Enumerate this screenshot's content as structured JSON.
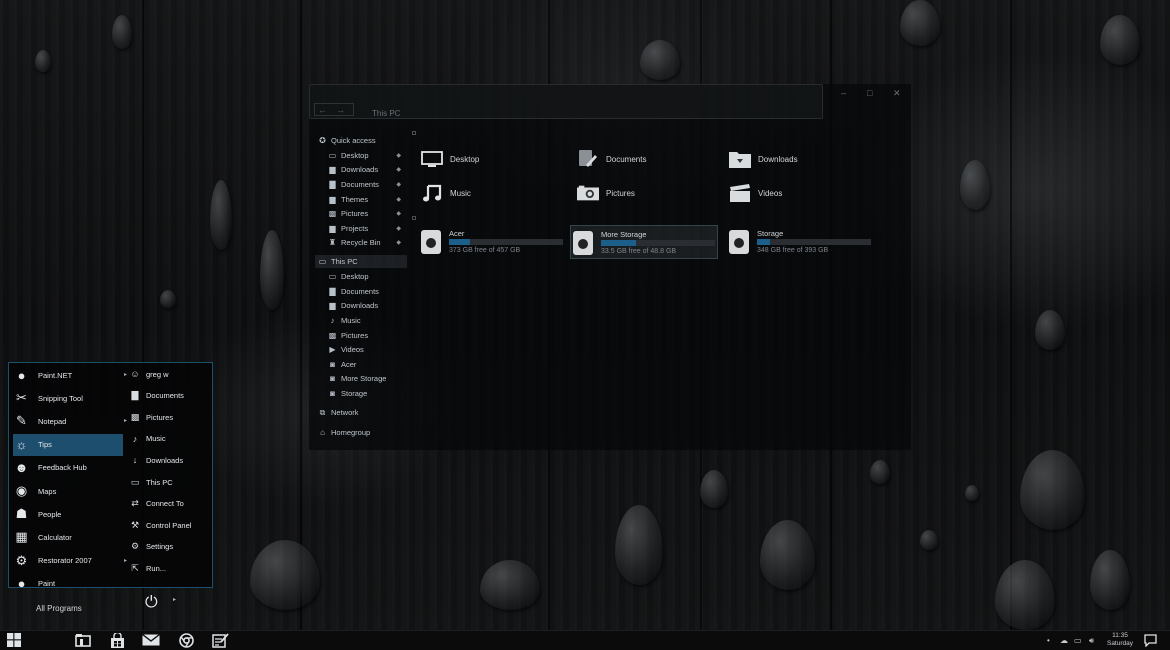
{
  "explorer": {
    "title": "This PC",
    "nav": {
      "back": "←",
      "forward": "→"
    },
    "window_controls": {
      "minimize": "–",
      "maximize": "□",
      "close": "✕"
    },
    "sidebar": [
      {
        "label": "Quick access",
        "icon": "quick-access-icon",
        "level": 0,
        "pinned": false
      },
      {
        "label": "Desktop",
        "icon": "desktop-icon",
        "level": 1,
        "pinned": true
      },
      {
        "label": "Downloads",
        "icon": "downloads-folder-icon",
        "level": 1,
        "pinned": true
      },
      {
        "label": "Documents",
        "icon": "documents-icon",
        "level": 1,
        "pinned": true
      },
      {
        "label": "Themes",
        "icon": "folder-icon",
        "level": 1,
        "pinned": true
      },
      {
        "label": "Pictures",
        "icon": "pictures-icon",
        "level": 1,
        "pinned": true
      },
      {
        "label": "Projects",
        "icon": "folder-icon",
        "level": 1,
        "pinned": true
      },
      {
        "label": "Recycle Bin",
        "icon": "recycle-bin-icon",
        "level": 1,
        "pinned": true
      },
      {
        "label": "This PC",
        "icon": "computer-icon",
        "level": 0,
        "pinned": false,
        "selected": true
      },
      {
        "label": "Desktop",
        "icon": "desktop-icon",
        "level": 1,
        "pinned": false
      },
      {
        "label": "Documents",
        "icon": "documents-icon",
        "level": 1,
        "pinned": false
      },
      {
        "label": "Downloads",
        "icon": "downloads-folder-icon",
        "level": 1,
        "pinned": false
      },
      {
        "label": "Music",
        "icon": "music-icon",
        "level": 1,
        "pinned": false
      },
      {
        "label": "Pictures",
        "icon": "pictures-icon",
        "level": 1,
        "pinned": false
      },
      {
        "label": "Videos",
        "icon": "videos-icon",
        "level": 1,
        "pinned": false
      },
      {
        "label": "Acer",
        "icon": "drive-icon",
        "level": 1,
        "pinned": false
      },
      {
        "label": "More Storage",
        "icon": "drive-icon",
        "level": 1,
        "pinned": false
      },
      {
        "label": "Storage",
        "icon": "drive-icon",
        "level": 1,
        "pinned": false
      },
      {
        "label": "Network",
        "icon": "network-icon",
        "level": 0,
        "pinned": false
      },
      {
        "label": "Homegroup",
        "icon": "homegroup-icon",
        "level": 0,
        "pinned": false
      }
    ],
    "folders": [
      {
        "label": "Desktop",
        "icon": "desktop-icon"
      },
      {
        "label": "Documents",
        "icon": "documents-icon"
      },
      {
        "label": "Downloads",
        "icon": "downloads-folder-icon"
      },
      {
        "label": "Music",
        "icon": "music-icon"
      },
      {
        "label": "Pictures",
        "icon": "camera-icon"
      },
      {
        "label": "Videos",
        "icon": "clapperboard-icon"
      }
    ],
    "drives": [
      {
        "name": "Acer",
        "free_text": "373 GB free of 457 GB",
        "used_fraction": 0.18,
        "selected": false
      },
      {
        "name": "More Storage",
        "free_text": "33.5 GB free of 48.8 GB",
        "used_fraction": 0.31,
        "selected": true
      },
      {
        "name": "Storage",
        "free_text": "348 GB free of 393 GB",
        "used_fraction": 0.11,
        "selected": false
      }
    ]
  },
  "start_menu": {
    "apps": [
      {
        "label": "Paint.NET",
        "icon": "paint-net-icon",
        "has_submenu": true
      },
      {
        "label": "Snipping Tool",
        "icon": "snipping-tool-icon",
        "has_submenu": false
      },
      {
        "label": "Notepad",
        "icon": "notepad-icon",
        "has_submenu": true
      },
      {
        "label": "Tips",
        "icon": "lightbulb-icon",
        "has_submenu": false,
        "selected": true
      },
      {
        "label": "Feedback Hub",
        "icon": "feedback-icon",
        "has_submenu": false
      },
      {
        "label": "Maps",
        "icon": "maps-icon",
        "has_submenu": false
      },
      {
        "label": "People",
        "icon": "people-icon",
        "has_submenu": false
      },
      {
        "label": "Calculator",
        "icon": "calculator-icon",
        "has_submenu": false
      },
      {
        "label": "Restorator 2007",
        "icon": "gear-icon",
        "has_submenu": true
      },
      {
        "label": "Paint",
        "icon": "paint-icon",
        "has_submenu": false
      }
    ],
    "places": [
      {
        "label": "greg w",
        "icon": "user-icon"
      },
      {
        "label": "Documents",
        "icon": "documents-icon"
      },
      {
        "label": "Pictures",
        "icon": "pictures-icon"
      },
      {
        "label": "Music",
        "icon": "music-icon"
      },
      {
        "label": "Downloads",
        "icon": "download-arrow-icon"
      },
      {
        "label": "This PC",
        "icon": "computer-icon"
      },
      {
        "label": "Connect To",
        "icon": "connect-icon"
      },
      {
        "label": "Control Panel",
        "icon": "wrench-icon"
      },
      {
        "label": "Settings",
        "icon": "gear-icon"
      },
      {
        "label": "Run...",
        "icon": "run-icon"
      }
    ],
    "all_programs": "All Programs",
    "power_icon": "power-icon"
  },
  "taskbar": {
    "pinned": [
      "windows-start-icon",
      "file-explorer-icon",
      "store-icon",
      "mail-icon",
      "browser-icon",
      "notes-icon"
    ],
    "tray": [
      "notification-chevron-icon",
      "cloud-icon",
      "network-icon",
      "volume-icon"
    ],
    "clock": {
      "time": "11:35",
      "day": "Saturday"
    },
    "action_center_icon": "action-center-icon"
  },
  "colors": {
    "accent": "#1e4e6e",
    "start_border": "#286e96",
    "drive_bar": "#1b5f8a"
  }
}
